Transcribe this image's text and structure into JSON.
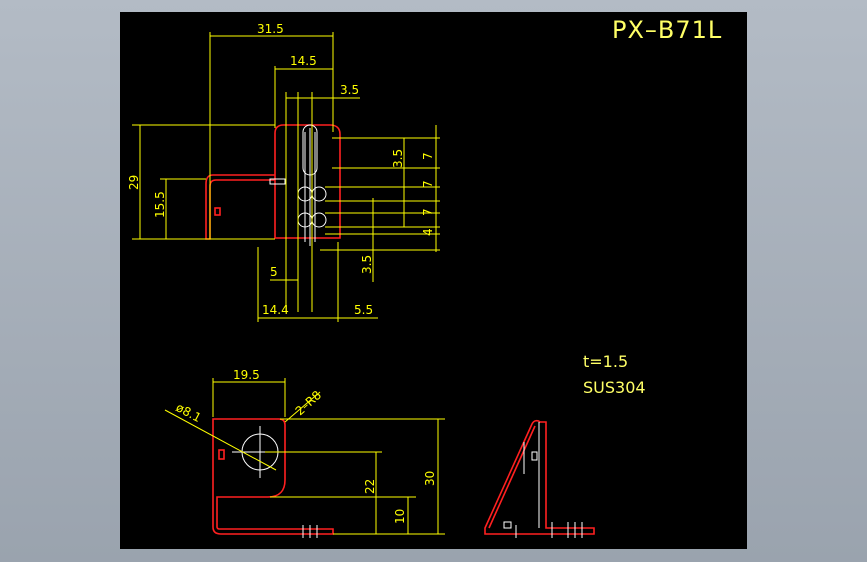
{
  "drawing": {
    "title": "PX–B71L",
    "notes": [
      "t=1.5",
      "SUS304"
    ],
    "top_view": {
      "dims": {
        "w_31_5": "31.5",
        "w_14_5": "14.5",
        "w_3_5_top": "3.5",
        "h_29": "29",
        "h_15_5": "15.5",
        "h_3_5_right": "3.5",
        "h_7_a": "7",
        "h_7_b": "7",
        "h_7_c": "7",
        "h_4": "4",
        "w_5": "5",
        "h_3_5_bottom": "3.5",
        "w_14_4": "14.4",
        "w_5_5": "5.5"
      }
    },
    "front_view": {
      "dims": {
        "w_19_5": "19.5",
        "dia_8_1": "ø8.1",
        "r_2_r8": "2–R8",
        "h_22": "22",
        "h_30": "30",
        "h_10": "10"
      }
    }
  }
}
